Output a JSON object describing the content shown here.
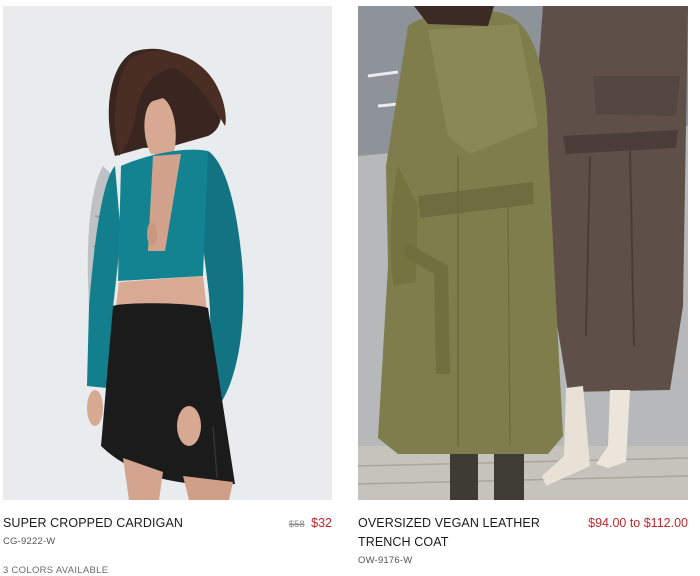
{
  "products": [
    {
      "name": "SUPER CROPPED CARDIGAN",
      "sku": "CG-9222-W",
      "price_original": "$58",
      "price_sale": "$32",
      "colors_available": "3 COLORS AVAILABLE"
    },
    {
      "name": "OVERSIZED VEGAN LEATHER TRENCH COAT",
      "sku": "OW-9176-W",
      "price_range": "$94.00 to $112.00"
    }
  ],
  "colors": {
    "sale_price": "#c0272d",
    "photo_background_1": "#eceef0",
    "cardigan_teal": "#137f8c",
    "skirt_black": "#1b1b1b",
    "coat_olive": "#7f7d4c",
    "coat_brown": "#5e4f49"
  }
}
